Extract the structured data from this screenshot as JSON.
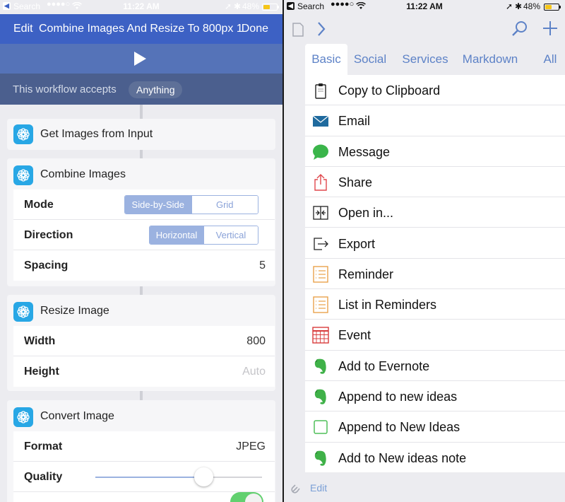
{
  "status_bar": {
    "back_label": "Search",
    "signal": "●●●●○",
    "time": "11:22 AM",
    "battery_text": "48%",
    "battery_level": 0.48
  },
  "left": {
    "nav": {
      "edit_label": "Edit",
      "title": "Combine Images And Resize To 800px 1",
      "done_label": "Done"
    },
    "accepts": {
      "label": "This workflow accepts",
      "value": "Anything"
    },
    "cards": {
      "get_images": {
        "title": "Get Images from Input"
      },
      "combine": {
        "title": "Combine Images",
        "mode": {
          "label": "Mode",
          "options": [
            "Side-by-Side",
            "Grid"
          ],
          "selected": 0
        },
        "direction": {
          "label": "Direction",
          "options": [
            "Horizontal",
            "Vertical"
          ],
          "selected": 0
        },
        "spacing": {
          "label": "Spacing",
          "value": "5"
        }
      },
      "resize": {
        "title": "Resize Image",
        "width": {
          "label": "Width",
          "value": "800"
        },
        "height": {
          "label": "Height",
          "placeholder": "Auto"
        }
      },
      "convert": {
        "title": "Convert Image",
        "format": {
          "label": "Format",
          "value": "JPEG"
        },
        "quality": {
          "label": "Quality",
          "level": 0.65
        },
        "preserve_metadata": {
          "on": true
        }
      }
    }
  },
  "right": {
    "tabs": [
      {
        "label": "Basic",
        "selected": true
      },
      {
        "label": "Social"
      },
      {
        "label": "Services"
      },
      {
        "label": "Markdown"
      },
      {
        "label": "All"
      }
    ],
    "actions": [
      {
        "label": "Copy to Clipboard",
        "icon": "clipboard-icon"
      },
      {
        "label": "Email",
        "icon": "email-icon"
      },
      {
        "label": "Message",
        "icon": "message-icon"
      },
      {
        "label": "Share",
        "icon": "share-icon"
      },
      {
        "label": "Open in...",
        "icon": "open-in-icon"
      },
      {
        "label": "Export",
        "icon": "export-icon"
      },
      {
        "label": "Reminder",
        "icon": "reminder-icon"
      },
      {
        "label": "List in Reminders",
        "icon": "list-reminders-icon"
      },
      {
        "label": "Event",
        "icon": "calendar-icon"
      },
      {
        "label": "Add to Evernote",
        "icon": "evernote-icon"
      },
      {
        "label": "Append to new ideas",
        "icon": "evernote-icon"
      },
      {
        "label": "Append to New Ideas",
        "icon": "checkbox-icon"
      },
      {
        "label": "Add to New ideas note",
        "icon": "evernote-icon"
      }
    ],
    "bottom": {
      "edit_label": "Edit"
    }
  },
  "colors": {
    "nav_blue": "#3d61c4",
    "tab_blue": "#5d82c7",
    "action_icon_blue": "#28a7e5",
    "evernote_green": "#3fb148",
    "message_green": "#3ab54a"
  }
}
